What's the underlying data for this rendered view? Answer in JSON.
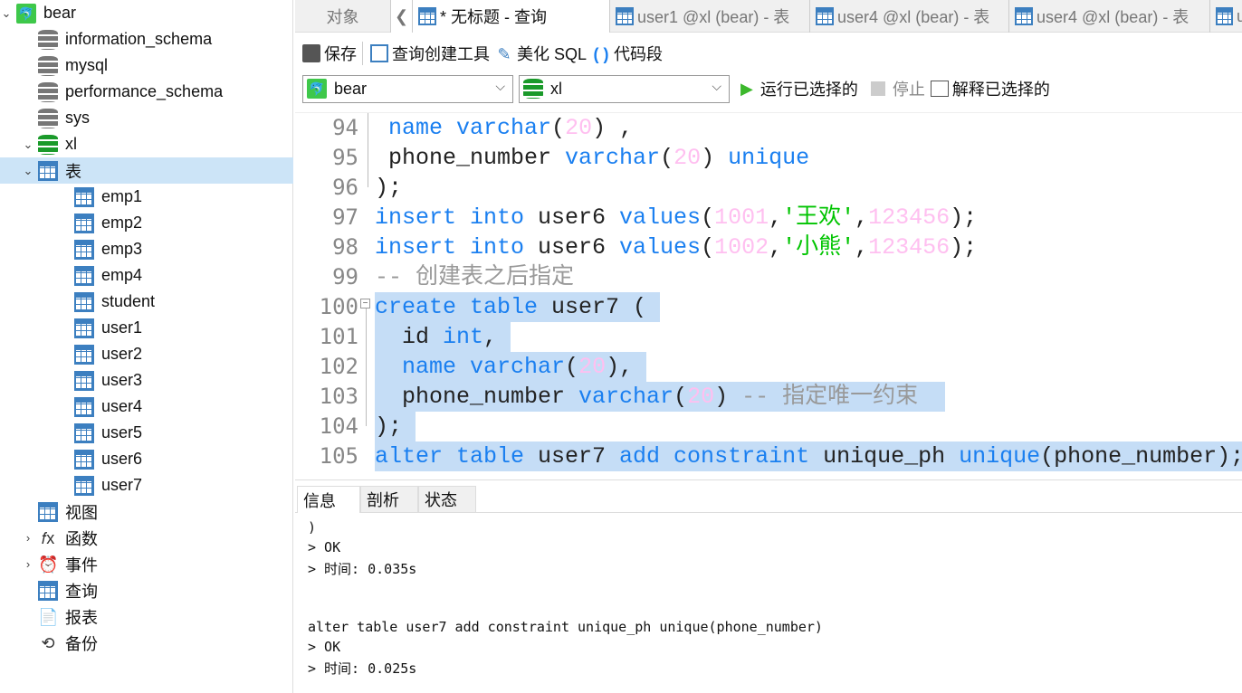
{
  "sidebar": {
    "items": [
      {
        "label": "bear",
        "icon": "mysql-connection-icon",
        "chev": "v",
        "indent": 0
      },
      {
        "label": "information_schema",
        "icon": "database-icon",
        "indent": 1
      },
      {
        "label": "mysql",
        "icon": "database-icon",
        "indent": 1
      },
      {
        "label": "performance_schema",
        "icon": "database-icon",
        "indent": 1
      },
      {
        "label": "sys",
        "icon": "database-icon",
        "indent": 1
      },
      {
        "label": "xl",
        "icon": "database-open-icon",
        "chev": "v",
        "indent": 1
      },
      {
        "label": "表",
        "icon": "table-icon",
        "chev": "v",
        "indent": 2,
        "selected": true
      },
      {
        "label": "emp1",
        "icon": "table-icon",
        "indent": 3
      },
      {
        "label": "emp2",
        "icon": "table-icon",
        "indent": 3
      },
      {
        "label": "emp3",
        "icon": "table-icon",
        "indent": 3
      },
      {
        "label": "emp4",
        "icon": "table-icon",
        "indent": 3
      },
      {
        "label": "student",
        "icon": "table-icon",
        "indent": 3
      },
      {
        "label": "user1",
        "icon": "table-icon",
        "indent": 3
      },
      {
        "label": "user2",
        "icon": "table-icon",
        "indent": 3
      },
      {
        "label": "user3",
        "icon": "table-icon",
        "indent": 3
      },
      {
        "label": "user4",
        "icon": "table-icon",
        "indent": 3
      },
      {
        "label": "user5",
        "icon": "table-icon",
        "indent": 3
      },
      {
        "label": "user6",
        "icon": "table-icon",
        "indent": 3
      },
      {
        "label": "user7",
        "icon": "table-icon",
        "indent": 3
      },
      {
        "label": "视图",
        "icon": "view-icon",
        "indent": 2
      },
      {
        "label": "函数",
        "icon": "function-icon",
        "chev": ">",
        "indent": 2
      },
      {
        "label": "事件",
        "icon": "event-clock-icon",
        "chev": ">",
        "indent": 2
      },
      {
        "label": "查询",
        "icon": "query-icon",
        "indent": 2
      },
      {
        "label": "报表",
        "icon": "report-icon",
        "indent": 2
      },
      {
        "label": "备份",
        "icon": "backup-icon",
        "indent": 2
      }
    ]
  },
  "tabs": {
    "objects": "对象",
    "items": [
      {
        "label": "* 无标题 - 查询",
        "icon": "query-icon",
        "active": true
      },
      {
        "label": "user1 @xl (bear) - 表",
        "icon": "table-icon"
      },
      {
        "label": "user4 @xl (bear) - 表",
        "icon": "table-icon"
      },
      {
        "label": "user4 @xl (bear) - 表",
        "icon": "table-design-icon"
      },
      {
        "label": "u",
        "icon": "table-design-icon"
      }
    ]
  },
  "toolbar": {
    "save": "保存",
    "query_builder": "查询创建工具",
    "beautify": "美化 SQL",
    "snippet": "代码段"
  },
  "toolbar2": {
    "connection": "bear",
    "database": "xl",
    "run_selected": "运行已选择的",
    "stop": "停止",
    "explain_selected": "解释已选择的"
  },
  "editor": {
    "colors": {
      "keyword": "#1a7ff0",
      "number": "#ffbff0",
      "string": "#00c400",
      "comment": "#999999",
      "selection": "#c5ddf6"
    },
    "lines": [
      {
        "no": "94",
        "tokens": [
          [
            "p",
            " "
          ],
          [
            "k",
            "name varchar"
          ],
          [
            "p",
            "("
          ],
          [
            "n",
            "20"
          ],
          [
            "p",
            ") ,"
          ]
        ]
      },
      {
        "no": "95",
        "tokens": [
          [
            "p",
            " phone_number "
          ],
          [
            "k",
            "varchar"
          ],
          [
            "p",
            "("
          ],
          [
            "n",
            "20"
          ],
          [
            "p",
            ") "
          ],
          [
            "k",
            "unique"
          ]
        ]
      },
      {
        "no": "96",
        "tokens": [
          [
            "p",
            ");"
          ]
        ]
      },
      {
        "no": "97",
        "tokens": [
          [
            "k",
            "insert into "
          ],
          [
            "p",
            "user6 "
          ],
          [
            "k",
            "values"
          ],
          [
            "p",
            "("
          ],
          [
            "n",
            "1001"
          ],
          [
            "p",
            ","
          ],
          [
            "s",
            "'王欢'"
          ],
          [
            "p",
            ","
          ],
          [
            "n",
            "123456"
          ],
          [
            "p",
            ");"
          ]
        ]
      },
      {
        "no": "98",
        "tokens": [
          [
            "k",
            "insert into "
          ],
          [
            "p",
            "user6 "
          ],
          [
            "k",
            "values"
          ],
          [
            "p",
            "("
          ],
          [
            "n",
            "1002"
          ],
          [
            "p",
            ","
          ],
          [
            "s",
            "'小熊'"
          ],
          [
            "p",
            ","
          ],
          [
            "n",
            "123456"
          ],
          [
            "p",
            ");"
          ]
        ]
      },
      {
        "no": "99",
        "tokens": [
          [
            "c",
            "-- 创建表之后指定"
          ]
        ]
      },
      {
        "no": "100",
        "sel": true,
        "tokens": [
          [
            "k",
            "create table "
          ],
          [
            "p",
            "user7 ( "
          ]
        ]
      },
      {
        "no": "101",
        "sel": true,
        "tokens": [
          [
            "p",
            "  id "
          ],
          [
            "k",
            "int"
          ],
          [
            "p",
            ", "
          ]
        ]
      },
      {
        "no": "102",
        "sel": true,
        "tokens": [
          [
            "p",
            "  "
          ],
          [
            "k",
            "name varchar"
          ],
          [
            "p",
            "("
          ],
          [
            "n",
            "20"
          ],
          [
            "p",
            "), "
          ]
        ]
      },
      {
        "no": "103",
        "sel": true,
        "tokens": [
          [
            "p",
            "  phone_number "
          ],
          [
            "k",
            "varchar"
          ],
          [
            "p",
            "("
          ],
          [
            "n",
            "20"
          ],
          [
            "p",
            ") "
          ],
          [
            "c",
            "-- 指定唯一约束  "
          ]
        ]
      },
      {
        "no": "104",
        "sel": true,
        "tokens": [
          [
            "p",
            "); "
          ]
        ]
      },
      {
        "no": "105",
        "sel": true,
        "tokens": [
          [
            "k",
            "alter table "
          ],
          [
            "p",
            "user7 "
          ],
          [
            "k",
            "add constraint "
          ],
          [
            "p",
            "unique_ph "
          ],
          [
            "k",
            "unique"
          ],
          [
            "p",
            "(phone_number);"
          ]
        ]
      }
    ]
  },
  "bottom": {
    "tabs": [
      "信息",
      "剖析",
      "状态"
    ],
    "messages": [
      ")",
      "> OK",
      "> 时间: 0.035s",
      "",
      "",
      "alter table user7 add constraint unique_ph unique(phone_number)",
      "> OK",
      "> 时间: 0.025s"
    ]
  }
}
